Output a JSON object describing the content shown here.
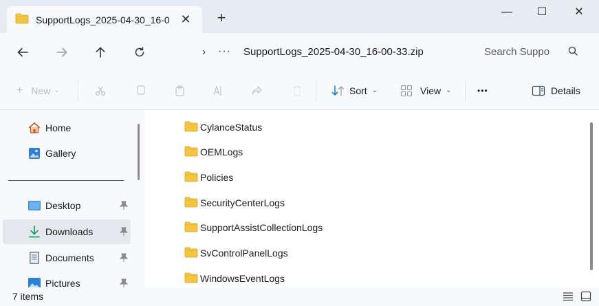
{
  "window": {
    "tab_title": "SupportLogs_2025-04-30_16-0",
    "tab_close": "✕",
    "new_tab": "+",
    "minimize": "—",
    "maximize": "☐",
    "close": "✕"
  },
  "address": {
    "chevron": "›",
    "more": "···",
    "path": "SupportLogs_2025-04-30_16-00-33.zip"
  },
  "search": {
    "placeholder": "Search Suppo"
  },
  "toolbar": {
    "new_label": "New",
    "sort_label": "Sort",
    "view_label": "View",
    "more": "•••",
    "details_label": "Details"
  },
  "sidebar": {
    "items": [
      {
        "label": "Home",
        "icon": "home-icon"
      },
      {
        "label": "Gallery",
        "icon": "gallery-icon"
      },
      {
        "label": "Desktop",
        "icon": "desktop-icon",
        "pinned": true
      },
      {
        "label": "Downloads",
        "icon": "download-icon",
        "pinned": true,
        "selected": true
      },
      {
        "label": "Documents",
        "icon": "documents-icon",
        "pinned": true
      },
      {
        "label": "Pictures",
        "icon": "pictures-icon",
        "pinned": true
      }
    ]
  },
  "files": [
    {
      "name": "CylanceStatus"
    },
    {
      "name": "OEMLogs"
    },
    {
      "name": "Policies"
    },
    {
      "name": "SecurityCenterLogs"
    },
    {
      "name": "SupportAssistCollectionLogs"
    },
    {
      "name": "SvControlPanelLogs"
    },
    {
      "name": "WindowsEventLogs"
    }
  ],
  "status": {
    "item_count": "7 items"
  },
  "colors": {
    "folder": "#f4c542",
    "accent": "#0067c0",
    "selected": "#e5e8ec"
  }
}
